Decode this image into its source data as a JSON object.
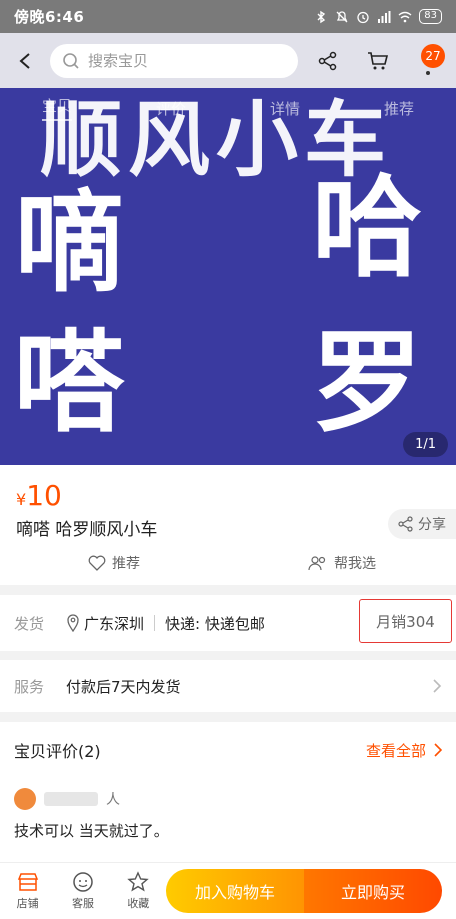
{
  "status_bar": {
    "time": "傍晚6:46",
    "battery": "83"
  },
  "header": {
    "search_placeholder": "搜索宝贝",
    "cart_badge": "27"
  },
  "tabs": [
    "宝贝",
    "评价",
    "详情",
    "推荐"
  ],
  "hero": {
    "banner_text": "顺风小车",
    "chars": [
      "嘀",
      "哈",
      "嗒",
      "罗"
    ],
    "counter": "1/1",
    "bg_color": "#3a3aa0"
  },
  "product": {
    "currency": "¥",
    "price": "10",
    "title": "嘀嗒 哈罗顺风小车",
    "share_label": "分享",
    "recommend_label": "推荐",
    "help_choose_label": "帮我选"
  },
  "shipping": {
    "label": "发货",
    "location": "广东深圳",
    "express": "快递: 快递包邮",
    "monthly_sales": "月销304"
  },
  "service": {
    "label": "服务",
    "value": "付款后7天内发货"
  },
  "reviews": {
    "title": "宝贝评价(2)",
    "view_all": "查看全部",
    "reviewer_suffix": "人",
    "text": "技术可以 当天就过了。"
  },
  "bottom_bar": {
    "store": "店铺",
    "service": "客服",
    "favorite": "收藏",
    "add_cart": "加入购物车",
    "buy_now": "立即购买"
  },
  "colors": {
    "accent": "#ff5000",
    "highlight_border": "#e53935"
  }
}
